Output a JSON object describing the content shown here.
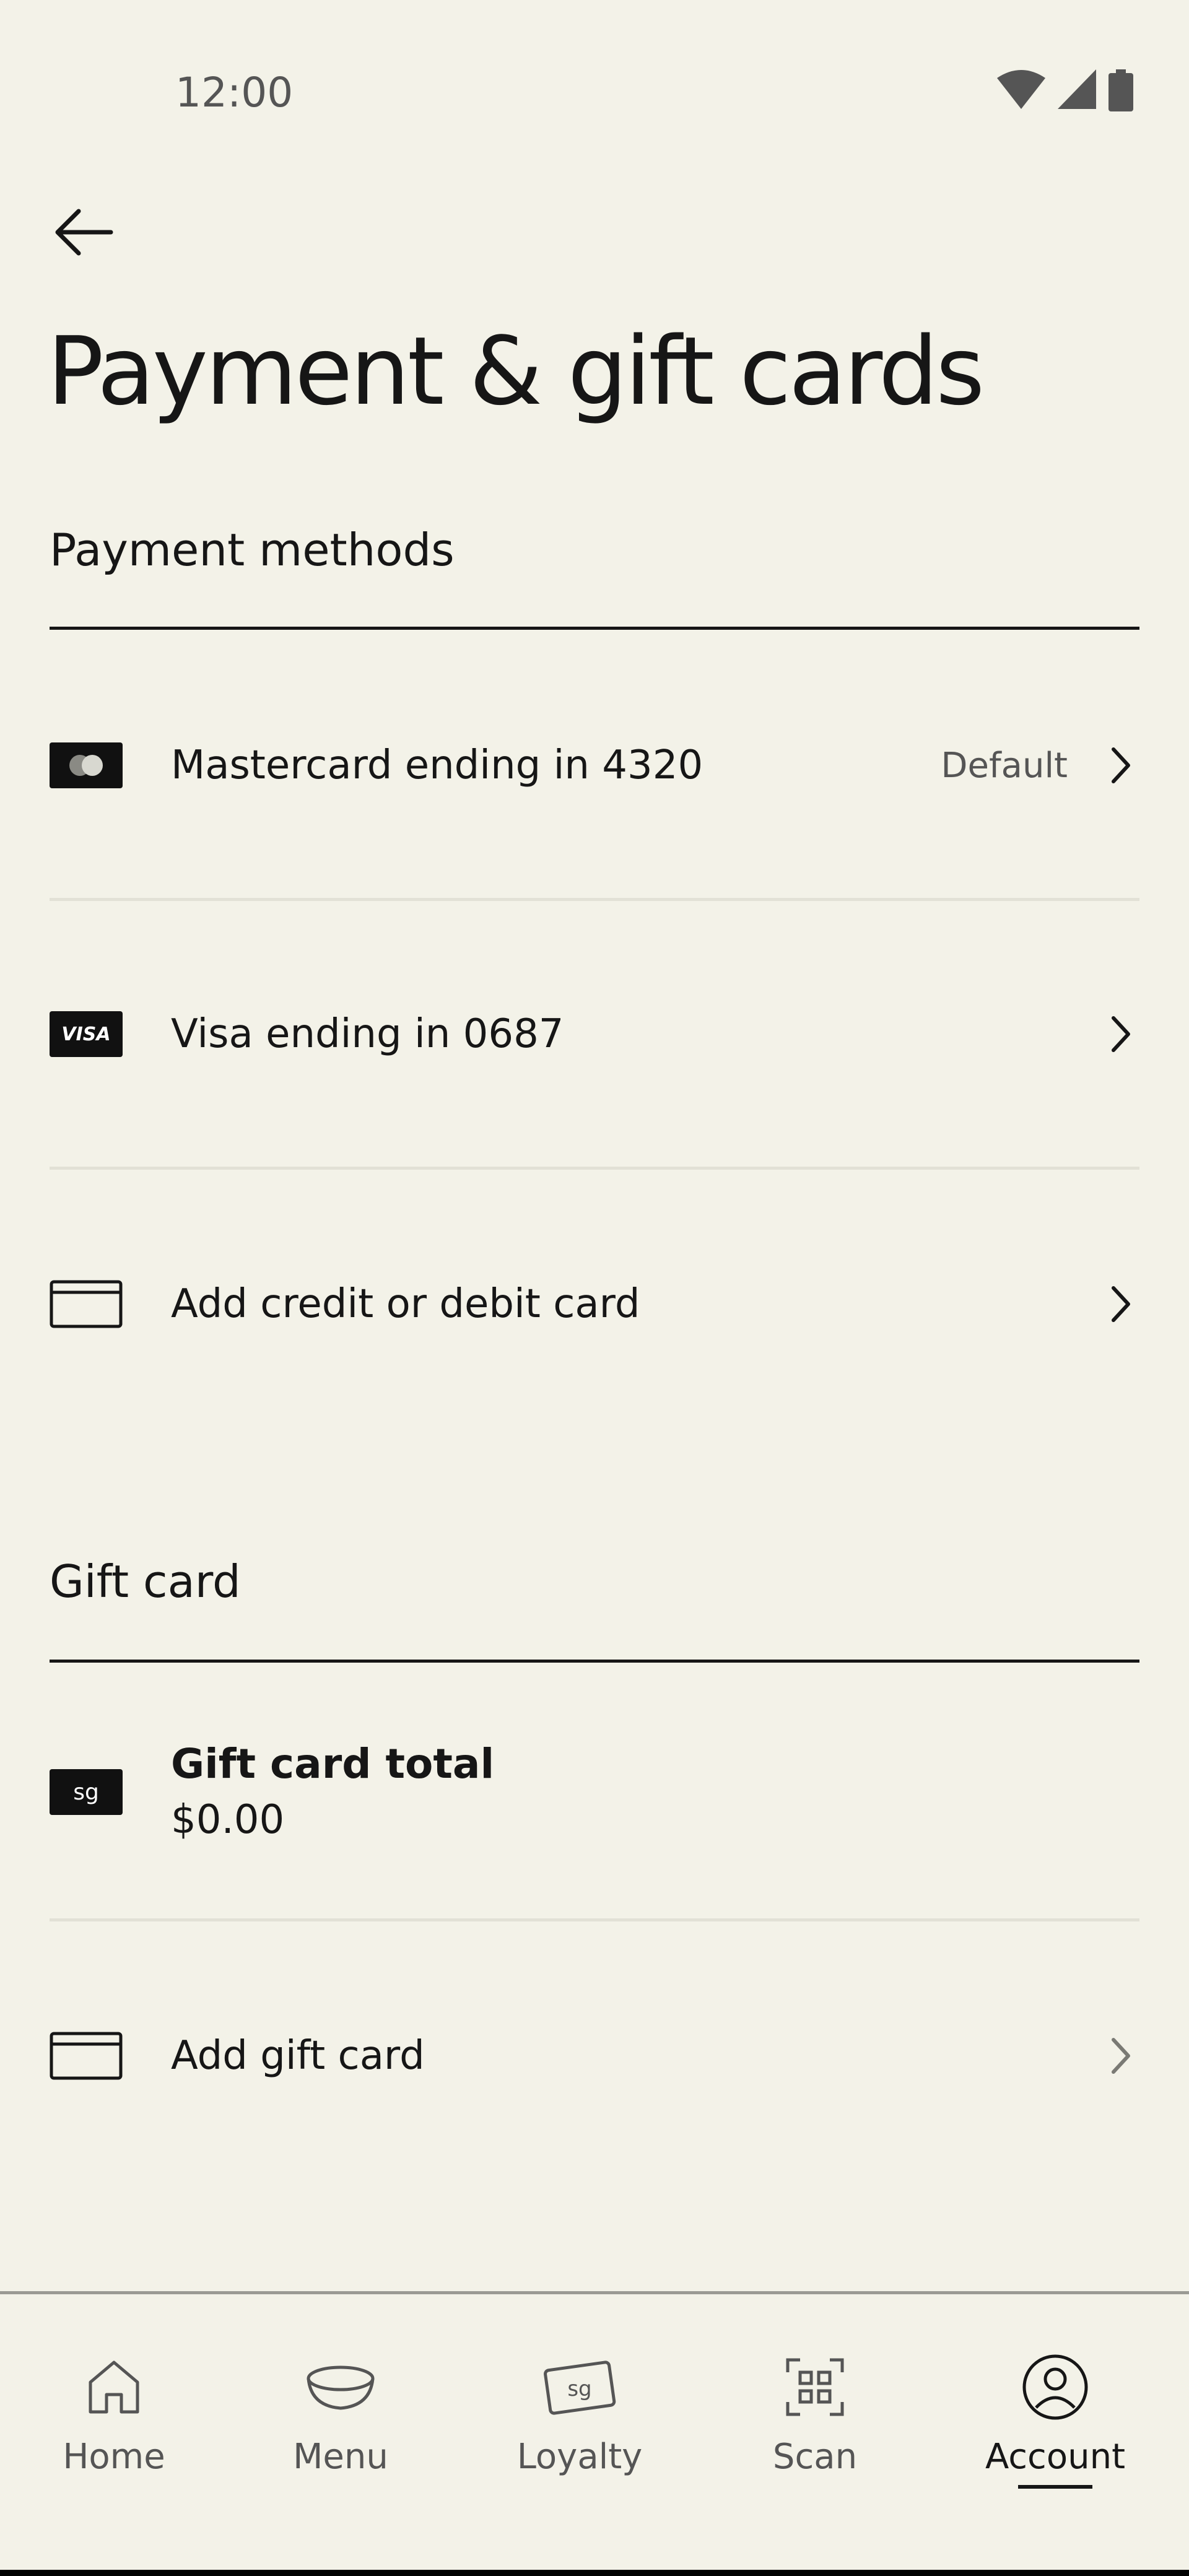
{
  "status_bar": {
    "time": "12:00"
  },
  "page": {
    "title": "Payment & gift cards"
  },
  "payment_methods": {
    "heading": "Payment methods",
    "items": [
      {
        "label": "Mastercard ending in 4320",
        "meta": "Default",
        "icon": "mastercard-icon"
      },
      {
        "label": "Visa ending in 0687",
        "meta": "",
        "icon": "visa-icon",
        "icon_text": "VISA"
      },
      {
        "label": "Add credit or debit card",
        "meta": "",
        "icon": "card-outline-icon"
      }
    ]
  },
  "gift_card": {
    "heading": "Gift card",
    "total_label": "Gift card total",
    "total_amount": "$0.00",
    "icon_text": "sg",
    "add_label": "Add gift card"
  },
  "bottom_nav": {
    "items": [
      {
        "label": "Home",
        "icon": "home-icon"
      },
      {
        "label": "Menu",
        "icon": "bowl-icon"
      },
      {
        "label": "Loyalty",
        "icon": "loyalty-card-icon",
        "icon_text": "sg"
      },
      {
        "label": "Scan",
        "icon": "qr-scan-icon"
      },
      {
        "label": "Account",
        "icon": "account-icon",
        "active": true
      }
    ]
  },
  "colors": {
    "background": "#F3F2E8",
    "text": "#161616",
    "muted": "#555555",
    "divider": "#E2E1D6"
  }
}
